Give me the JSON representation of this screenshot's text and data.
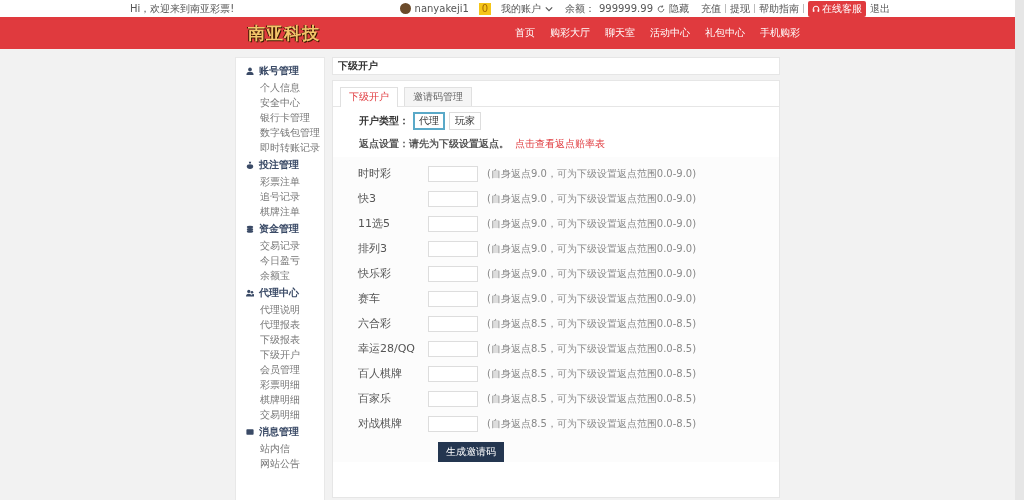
{
  "topbar": {
    "welcome": "Hi，欢迎来到南亚彩票!",
    "username": "nanyakeji1",
    "vip": "0",
    "account_menu": "我的账户",
    "balance_label": "余额：",
    "balance": "999999.99",
    "hide": "隐藏",
    "links": [
      "充值",
      "提现",
      "帮助指南"
    ],
    "service": "在线客服",
    "logout": "退出"
  },
  "logo": "南亚科技",
  "nav": [
    {
      "label": "首页"
    },
    {
      "label": "购彩大厅"
    },
    {
      "label": "聊天室"
    },
    {
      "label": "活动中心"
    },
    {
      "label": "礼包中心"
    },
    {
      "label": "手机购彩"
    }
  ],
  "sidebar": [
    {
      "title": "账号管理",
      "kind": "user",
      "items": [
        {
          "label": "个人信息"
        },
        {
          "label": "安全中心"
        },
        {
          "label": "银行卡管理"
        },
        {
          "label": "数字钱包管理"
        },
        {
          "label": "即时转账记录"
        }
      ]
    },
    {
      "title": "投注管理",
      "kind": "bag",
      "items": [
        {
          "label": "彩票注单"
        },
        {
          "label": "追号记录"
        },
        {
          "label": "棋牌注单"
        }
      ]
    },
    {
      "title": "资金管理",
      "kind": "money",
      "items": [
        {
          "label": "交易记录"
        },
        {
          "label": "今日盈亏"
        },
        {
          "label": "余额宝"
        }
      ]
    },
    {
      "title": "代理中心",
      "kind": "group",
      "items": [
        {
          "label": "代理说明"
        },
        {
          "label": "代理报表"
        },
        {
          "label": "下级报表"
        },
        {
          "label": "下级开户"
        },
        {
          "label": "会员管理"
        },
        {
          "label": "彩票明细"
        },
        {
          "label": "棋牌明细"
        },
        {
          "label": "交易明细"
        }
      ]
    },
    {
      "title": "消息管理",
      "kind": "message",
      "items": [
        {
          "label": "站内信"
        },
        {
          "label": "网站公告"
        }
      ]
    }
  ],
  "panel_title": "下级开户",
  "tabs": [
    {
      "label": "下级开户",
      "selected": true
    },
    {
      "label": "邀请码管理",
      "selected": false
    }
  ],
  "account_type": {
    "label": "开户类型：",
    "options": [
      {
        "label": "代理",
        "selected": true
      },
      {
        "label": "玩家",
        "selected": false
      }
    ]
  },
  "rebate": {
    "label": "返点设置：请先为下级设置返点。",
    "link": "点击查看返点赔率表"
  },
  "games": [
    {
      "name": "时时彩",
      "hint": "(自身返点9.0，可为下级设置返点范围0.0-9.0)"
    },
    {
      "name": "快3",
      "hint": "(自身返点9.0，可为下级设置返点范围0.0-9.0)"
    },
    {
      "name": "11选5",
      "hint": "(自身返点9.0，可为下级设置返点范围0.0-9.0)"
    },
    {
      "name": "排列3",
      "hint": "(自身返点9.0，可为下级设置返点范围0.0-9.0)"
    },
    {
      "name": "快乐彩",
      "hint": "(自身返点9.0，可为下级设置返点范围0.0-9.0)"
    },
    {
      "name": "赛车",
      "hint": "(自身返点9.0，可为下级设置返点范围0.0-9.0)"
    },
    {
      "name": "六合彩",
      "hint": "(自身返点8.5，可为下级设置返点范围0.0-8.5)"
    },
    {
      "name": "幸运28/QQ",
      "hint": "(自身返点8.5，可为下级设置返点范围0.0-8.5)"
    },
    {
      "name": "百人棋牌",
      "hint": "(自身返点8.5，可为下级设置返点范围0.0-8.5)"
    },
    {
      "name": "百家乐",
      "hint": "(自身返点8.5，可为下级设置返点范围0.0-8.5)"
    },
    {
      "name": "对战棋牌",
      "hint": "(自身返点8.5，可为下级设置返点范围0.0-8.5)"
    }
  ],
  "submit": "生成邀请码"
}
